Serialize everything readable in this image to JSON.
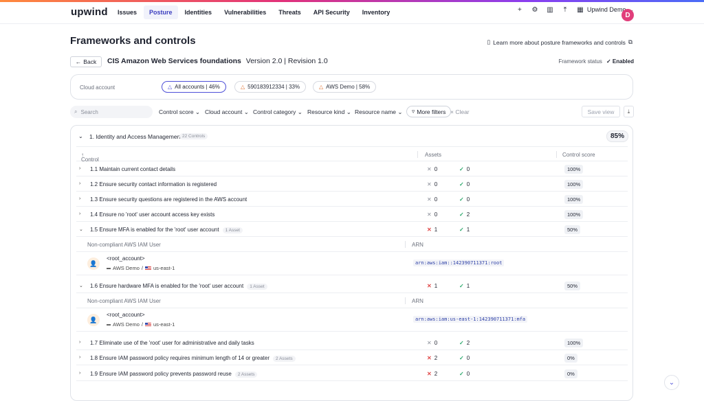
{
  "nav": {
    "logo": "upwind",
    "items": [
      "Issues",
      "Posture",
      "Identities",
      "Vulnerabilities",
      "Threats",
      "API Security",
      "Inventory"
    ],
    "user_label": "Upwind Demo",
    "avatar_initial": "D"
  },
  "header": {
    "title": "Frameworks and controls",
    "learn_link": "Learn more about posture frameworks and controls",
    "back_label": "Back",
    "framework_name": "CIS Amazon Web Services foundations",
    "framework_version": "Version 2.0 | Revision 1.0",
    "status_label": "Framework status",
    "status_value": "Enabled"
  },
  "accounts": {
    "label": "Cloud account",
    "chips": [
      {
        "label": "All accounts | 46%"
      },
      {
        "label": "590183912334 | 33%"
      },
      {
        "label": "AWS Demo | 58%"
      }
    ]
  },
  "filters": {
    "search_placeholder": "Search",
    "items": [
      "Control score",
      "Cloud account",
      "Control category",
      "Resource kind",
      "Resource name"
    ],
    "more_filters": "More filters",
    "clear": "Clear",
    "save_view": "Save view"
  },
  "section": {
    "title": "1. Identity and Access Management",
    "count": "22 Controls",
    "score": "85%",
    "col_control": "Control",
    "col_assets": "Assets",
    "col_score": "Control score"
  },
  "rows": [
    {
      "title": "1.1 Maintain current contact details",
      "badge": "",
      "fail": "0",
      "pass": "0",
      "score": "100%"
    },
    {
      "title": "1.2 Ensure security contact information is registered",
      "badge": "",
      "fail": "0",
      "pass": "0",
      "score": "100%"
    },
    {
      "title": "1.3 Ensure security questions are registered in the AWS account",
      "badge": "",
      "fail": "0",
      "pass": "0",
      "score": "100%"
    },
    {
      "title": "1.4 Ensure no 'root' user account access key exists",
      "badge": "",
      "fail": "0",
      "pass": "2",
      "score": "100%"
    },
    {
      "title": "1.5 Ensure MFA is enabled for the 'root' user account",
      "badge": "1 Asset",
      "fail": "1",
      "pass": "1",
      "score": "50%"
    },
    {
      "title": "1.6 Ensure hardware MFA is enabled for the 'root' user account",
      "badge": "1 Asset",
      "fail": "1",
      "pass": "1",
      "score": "50%"
    },
    {
      "title": "1.7 Eliminate use of the 'root' user for administrative and daily tasks",
      "badge": "",
      "fail": "0",
      "pass": "2",
      "score": "100%"
    },
    {
      "title": "1.8 Ensure IAM password policy requires minimum length of 14 or greater",
      "badge": "2 Assets",
      "fail": "2",
      "pass": "0",
      "score": "0%"
    },
    {
      "title": "1.9 Ensure IAM password policy prevents password reuse",
      "badge": "2 Assets",
      "fail": "2",
      "pass": "0",
      "score": "0%"
    }
  ],
  "sub_tables": [
    {
      "col_user": "Non-compliant AWS IAM User",
      "col_arn": "ARN",
      "name": "<root_account>",
      "account": "AWS Demo",
      "region": "us-east-1",
      "arn": "arn:aws:iam::142390711371:root"
    },
    {
      "col_user": "Non-compliant AWS IAM User",
      "col_arn": "ARN",
      "name": "<root_account>",
      "account": "AWS Demo",
      "region": "us-east-1",
      "arn": "arn:aws:iam:us-east-1:142390711371:mfa"
    }
  ]
}
